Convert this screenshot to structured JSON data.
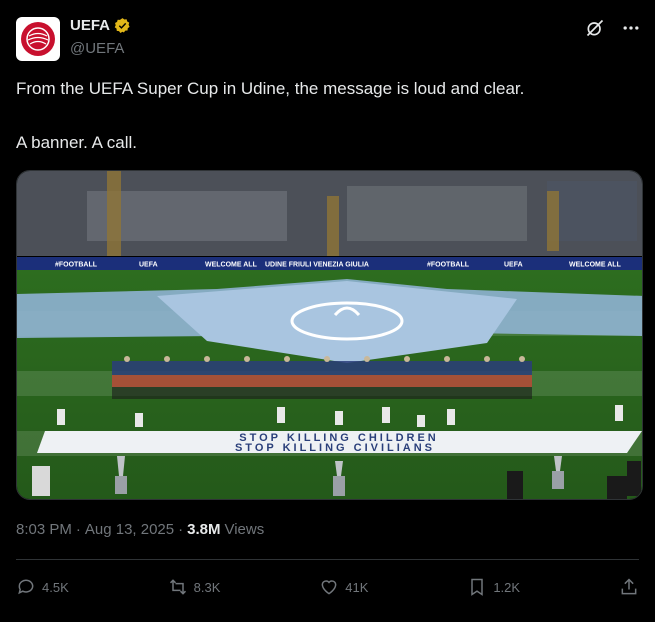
{
  "account": {
    "name": "UEFA",
    "handle": "@UEFA",
    "avatar_label": "UEFA"
  },
  "post": {
    "line1": "From the UEFA Super Cup in Udine, the message is loud and clear.",
    "line2": "A banner. A call."
  },
  "photo": {
    "ad_boards": [
      "#FOOTBALL",
      "UEFA",
      "WELCOME ALL",
      "UDINE FRIULI VENEZIA GIULIA",
      "#FOOTBALL",
      "UEFA",
      "WELCOME ALL"
    ],
    "banner_line1": "STOP KILLING CHILDREN",
    "banner_line2": "STOP KILLING CIVILIANS"
  },
  "meta": {
    "time": "8:03 PM",
    "separator": "·",
    "date": "Aug 13, 2025",
    "views_count": "3.8M",
    "views_label": "Views"
  },
  "actions": {
    "replies": "4.5K",
    "reposts": "8.3K",
    "likes": "41K",
    "bookmarks": "1.2K"
  },
  "colors": {
    "verified": "#e2b719",
    "muted": "#71767b",
    "pitch": "#2f6b1e"
  }
}
